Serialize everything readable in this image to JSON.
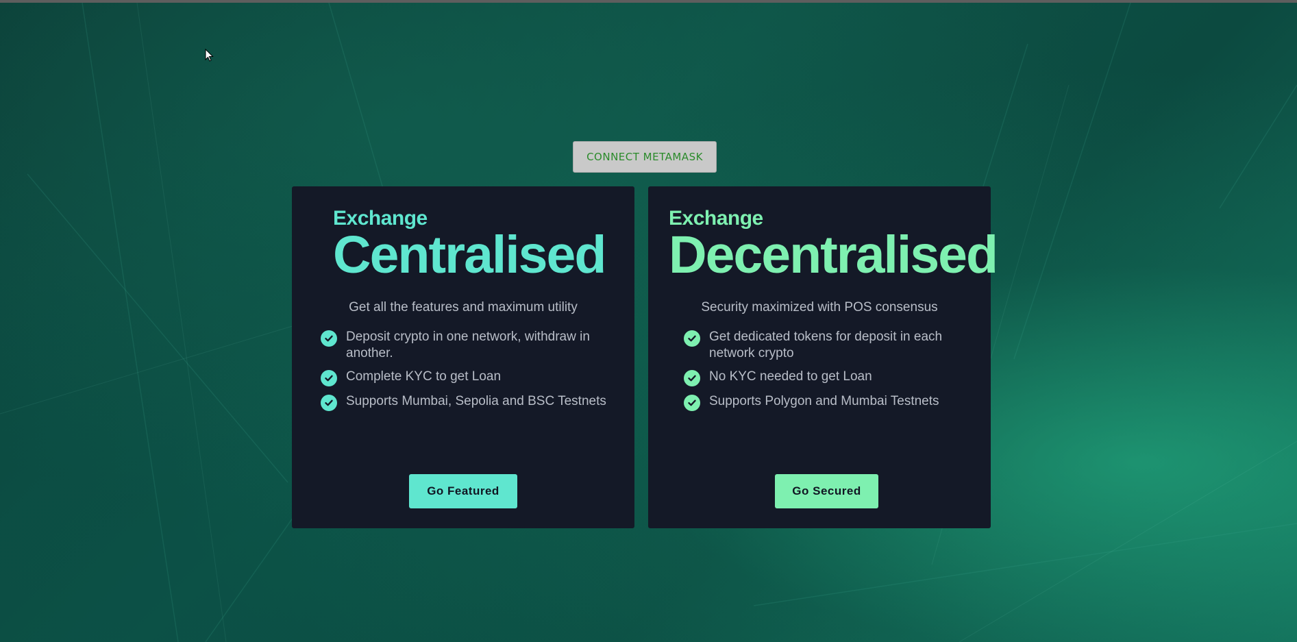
{
  "header": {
    "connect_label": "CONNECT METAMASK"
  },
  "cards": [
    {
      "eyebrow": "Exchange",
      "headline": "Centralised",
      "tagline": "Get all the features and maximum utility",
      "features": [
        "Deposit crypto in one network, withdraw in another.",
        "Complete KYC to get Loan",
        "Supports Mumbai, Sepolia and BSC Testnets"
      ],
      "cta_label": "Go Featured",
      "accent": "#5fe6cf"
    },
    {
      "eyebrow": "Exchange",
      "headline": "Decentralised",
      "tagline": "Security maximized with POS consensus",
      "features": [
        "Get dedicated tokens for deposit in each network crypto",
        "No KYC needed to get Loan",
        "Supports Polygon and Mumbai Testnets"
      ],
      "cta_label": "Go Secured",
      "accent": "#7ef0b0"
    }
  ],
  "icons": {
    "feature_bullet": "check-circle-icon",
    "pointer": "mouse-cursor-icon"
  },
  "colors": {
    "card_background": "#141927",
    "body_text": "#b9bec8",
    "connect_text": "#2a8a2a"
  }
}
